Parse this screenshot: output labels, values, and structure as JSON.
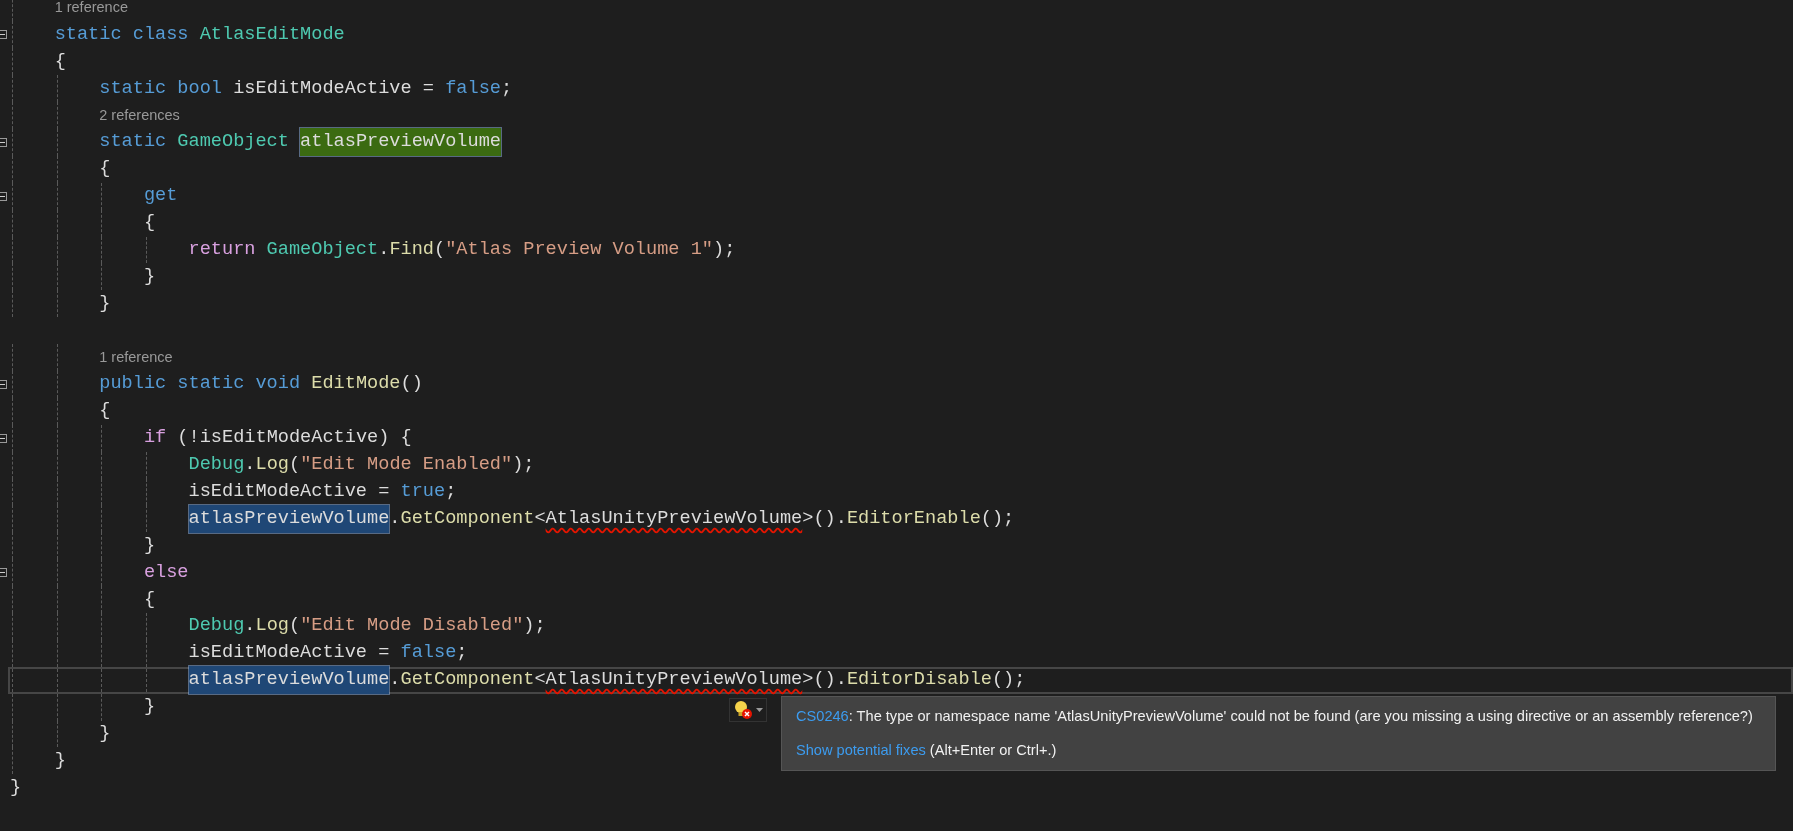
{
  "editor": {
    "lines": [
      {
        "kind": "lens",
        "text": "    1 reference"
      },
      {
        "kind": "code",
        "fold": true,
        "tokens": [
          {
            "kind": "keyword",
            "text": "    static class "
          },
          {
            "kind": "type",
            "text": "AtlasEditMode"
          }
        ]
      },
      {
        "kind": "code",
        "tokens": [
          {
            "kind": "plain",
            "text": "    {"
          }
        ]
      },
      {
        "kind": "code",
        "tokens": [
          {
            "kind": "keyword",
            "text": "        static bool "
          },
          {
            "kind": "plain",
            "text": "isEditModeActive = "
          },
          {
            "kind": "keyword",
            "text": "false"
          },
          {
            "kind": "plain",
            "text": ";"
          }
        ]
      },
      {
        "kind": "lens",
        "text": "        2 references"
      },
      {
        "kind": "code",
        "fold": true,
        "tokens": [
          {
            "kind": "keyword",
            "text": "        static "
          },
          {
            "kind": "type",
            "text": "GameObject "
          },
          {
            "kind": "plain",
            "text": "atlasPreviewVolume",
            "color": "#3b6b11"
          }
        ]
      },
      {
        "kind": "code",
        "tokens": [
          {
            "kind": "plain",
            "text": "        {"
          }
        ]
      },
      {
        "kind": "code",
        "fold": true,
        "tokens": [
          {
            "kind": "keyword",
            "text": "            get"
          }
        ]
      },
      {
        "kind": "code",
        "tokens": [
          {
            "kind": "plain",
            "text": "            {"
          }
        ]
      },
      {
        "kind": "code",
        "tokens": [
          {
            "kind": "control",
            "text": "                return "
          },
          {
            "kind": "type",
            "text": "GameObject"
          },
          {
            "kind": "plain",
            "text": "."
          },
          {
            "kind": "method",
            "text": "Find"
          },
          {
            "kind": "plain",
            "text": "("
          },
          {
            "kind": "string",
            "text": "\"Atlas Preview Volume 1\""
          },
          {
            "kind": "plain",
            "text": ");"
          }
        ]
      },
      {
        "kind": "code",
        "tokens": [
          {
            "kind": "plain",
            "text": "            }"
          }
        ]
      },
      {
        "kind": "code",
        "tokens": [
          {
            "kind": "plain",
            "text": "        }"
          }
        ]
      },
      {
        "kind": "code"
      },
      {
        "kind": "lens",
        "text": "        1 reference"
      },
      {
        "kind": "code",
        "fold": true,
        "tokens": [
          {
            "kind": "keyword",
            "text": "        public static void "
          },
          {
            "kind": "method",
            "text": "EditMode"
          },
          {
            "kind": "plain",
            "text": "()"
          }
        ]
      },
      {
        "kind": "code",
        "tokens": [
          {
            "kind": "plain",
            "text": "        {"
          }
        ]
      },
      {
        "kind": "code",
        "fold": true,
        "tokens": [
          {
            "kind": "control",
            "text": "            if"
          },
          {
            "kind": "plain",
            "text": " (!isEditModeActive) {"
          }
        ]
      },
      {
        "kind": "code",
        "tokens": [
          {
            "kind": "type",
            "text": "                Debug"
          },
          {
            "kind": "plain",
            "text": "."
          },
          {
            "kind": "method",
            "text": "Log"
          },
          {
            "kind": "plain",
            "text": "("
          },
          {
            "kind": "string",
            "text": "\"Edit Mode Enabled\""
          },
          {
            "kind": "plain",
            "text": ");"
          }
        ]
      },
      {
        "kind": "code",
        "tokens": [
          {
            "kind": "plain",
            "text": "                isEditModeActive = "
          },
          {
            "kind": "keyword",
            "text": "true"
          },
          {
            "kind": "plain",
            "text": ";"
          }
        ]
      },
      {
        "kind": "code",
        "tokens": [
          {
            "kind": "plain",
            "text": "                atlasPreviewVolume",
            "color": "#1f4776"
          },
          {
            "kind": "plain",
            "text": "."
          },
          {
            "kind": "method",
            "text": "GetComponent"
          },
          {
            "kind": "plain",
            "text": "<"
          },
          {
            "kind": "plain",
            "text": "AtlasUnityPreviewVolume",
            "error": true
          },
          {
            "kind": "plain",
            "text": ">()."
          },
          {
            "kind": "method",
            "text": "EditorEnable"
          },
          {
            "kind": "plain",
            "text": "();"
          }
        ]
      },
      {
        "kind": "code",
        "tokens": [
          {
            "kind": "plain",
            "text": "            }"
          }
        ]
      },
      {
        "kind": "code",
        "fold": true,
        "tokens": [
          {
            "kind": "control",
            "text": "            else"
          }
        ]
      },
      {
        "kind": "code",
        "tokens": [
          {
            "kind": "plain",
            "text": "            {"
          }
        ]
      },
      {
        "kind": "code",
        "tokens": [
          {
            "kind": "type",
            "text": "                Debug"
          },
          {
            "kind": "plain",
            "text": "."
          },
          {
            "kind": "method",
            "text": "Log"
          },
          {
            "kind": "plain",
            "text": "("
          },
          {
            "kind": "string",
            "text": "\"Edit Mode Disabled\""
          },
          {
            "kind": "plain",
            "text": ");"
          }
        ]
      },
      {
        "kind": "code",
        "tokens": [
          {
            "kind": "plain",
            "text": "                isEditModeActive = "
          },
          {
            "kind": "keyword",
            "text": "false"
          },
          {
            "kind": "plain",
            "text": ";"
          }
        ]
      },
      {
        "kind": "code",
        "current": true,
        "tokens": [
          {
            "kind": "plain",
            "text": "                atlasPreviewVolume",
            "color": "#1f4776"
          },
          {
            "kind": "plain",
            "text": "."
          },
          {
            "kind": "method",
            "text": "GetComponent"
          },
          {
            "kind": "plain",
            "text": "<"
          },
          {
            "kind": "plain",
            "text": "AtlasUnityPreviewVolume",
            "error": true
          },
          {
            "kind": "plain",
            "text": ">()."
          },
          {
            "kind": "method",
            "text": "EditorDisable"
          },
          {
            "kind": "plain",
            "text": "();"
          }
        ]
      },
      {
        "kind": "code",
        "tokens": [
          {
            "kind": "plain",
            "text": "            }"
          }
        ]
      },
      {
        "kind": "code",
        "tokens": [
          {
            "kind": "plain",
            "text": "        }"
          }
        ]
      },
      {
        "kind": "code",
        "tokens": [
          {
            "kind": "plain",
            "text": "    }"
          }
        ]
      },
      {
        "kind": "code",
        "tokens": [
          {
            "kind": "plain",
            "text": "}"
          }
        ]
      }
    ]
  },
  "error_tooltip": {
    "code": "CS0246",
    "message": ": The type or namespace name 'AtlasUnityPreviewVolume' could not be found (are you missing a using directive or an assembly reference?)",
    "fix_link": "Show potential fixes",
    "shortcut": "(Alt+Enter or Ctrl+.)"
  }
}
